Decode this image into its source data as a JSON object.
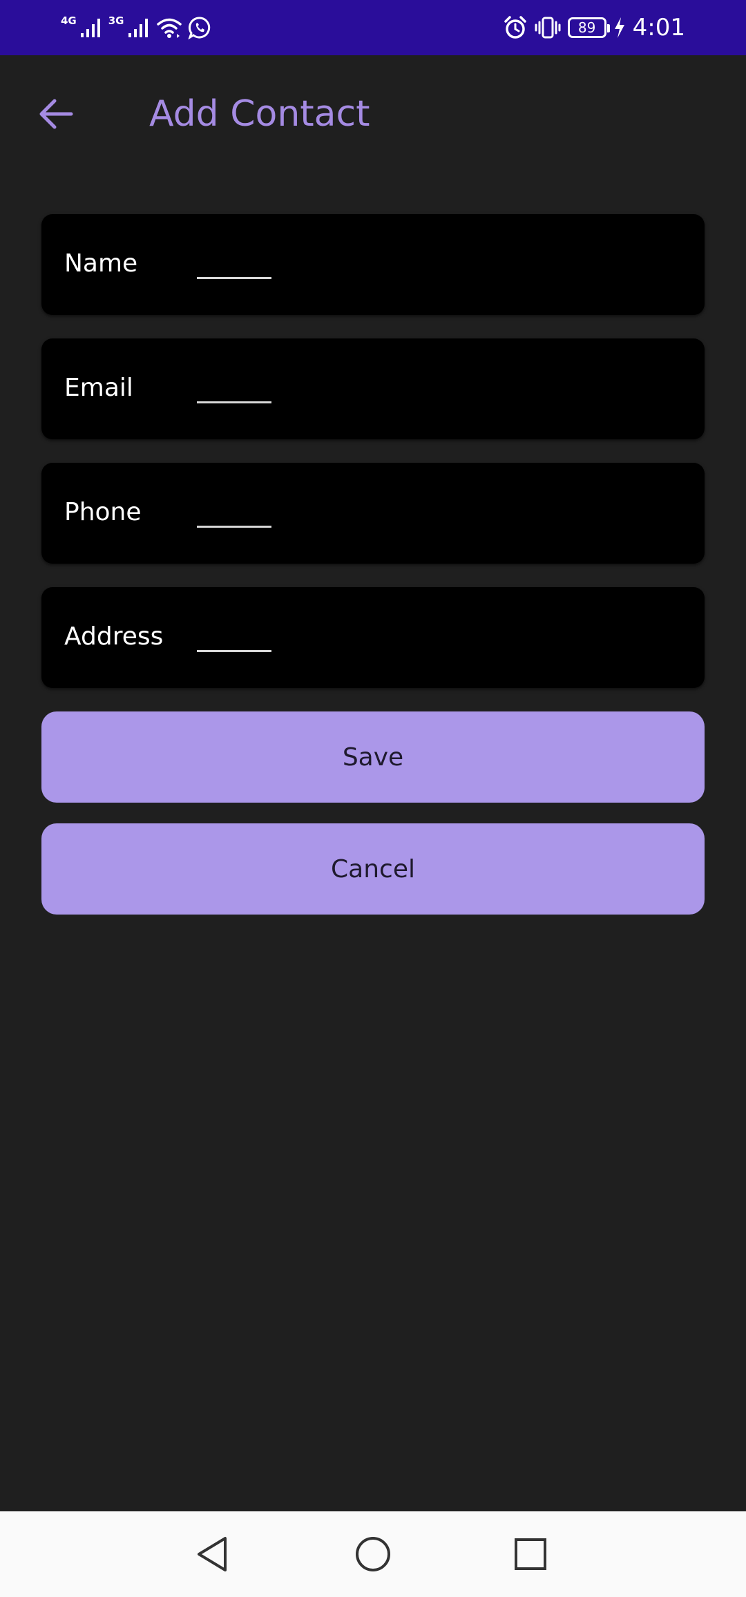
{
  "status_bar": {
    "network_1": "4G",
    "network_2": "3G",
    "battery_level": "89",
    "time": "4:01",
    "icons": [
      "signal-icon",
      "signal-icon",
      "wifi-icon",
      "whatsapp-icon",
      "alarm-icon",
      "vibrate-icon",
      "battery-icon",
      "charging-icon"
    ],
    "background_color": "#2a0d9a"
  },
  "app_bar": {
    "title": "Add Contact",
    "back_icon": "arrow-back-icon",
    "accent_color": "#a58be3"
  },
  "form": {
    "fields": [
      {
        "label": "Name",
        "value": ""
      },
      {
        "label": "Email",
        "value": ""
      },
      {
        "label": "Phone",
        "value": ""
      },
      {
        "label": "Address",
        "value": ""
      }
    ],
    "save_label": "Save",
    "cancel_label": "Cancel",
    "button_color": "#ab97e9"
  },
  "nav_bar": {
    "icons": [
      "nav-back-icon",
      "nav-home-icon",
      "nav-recents-icon"
    ]
  }
}
